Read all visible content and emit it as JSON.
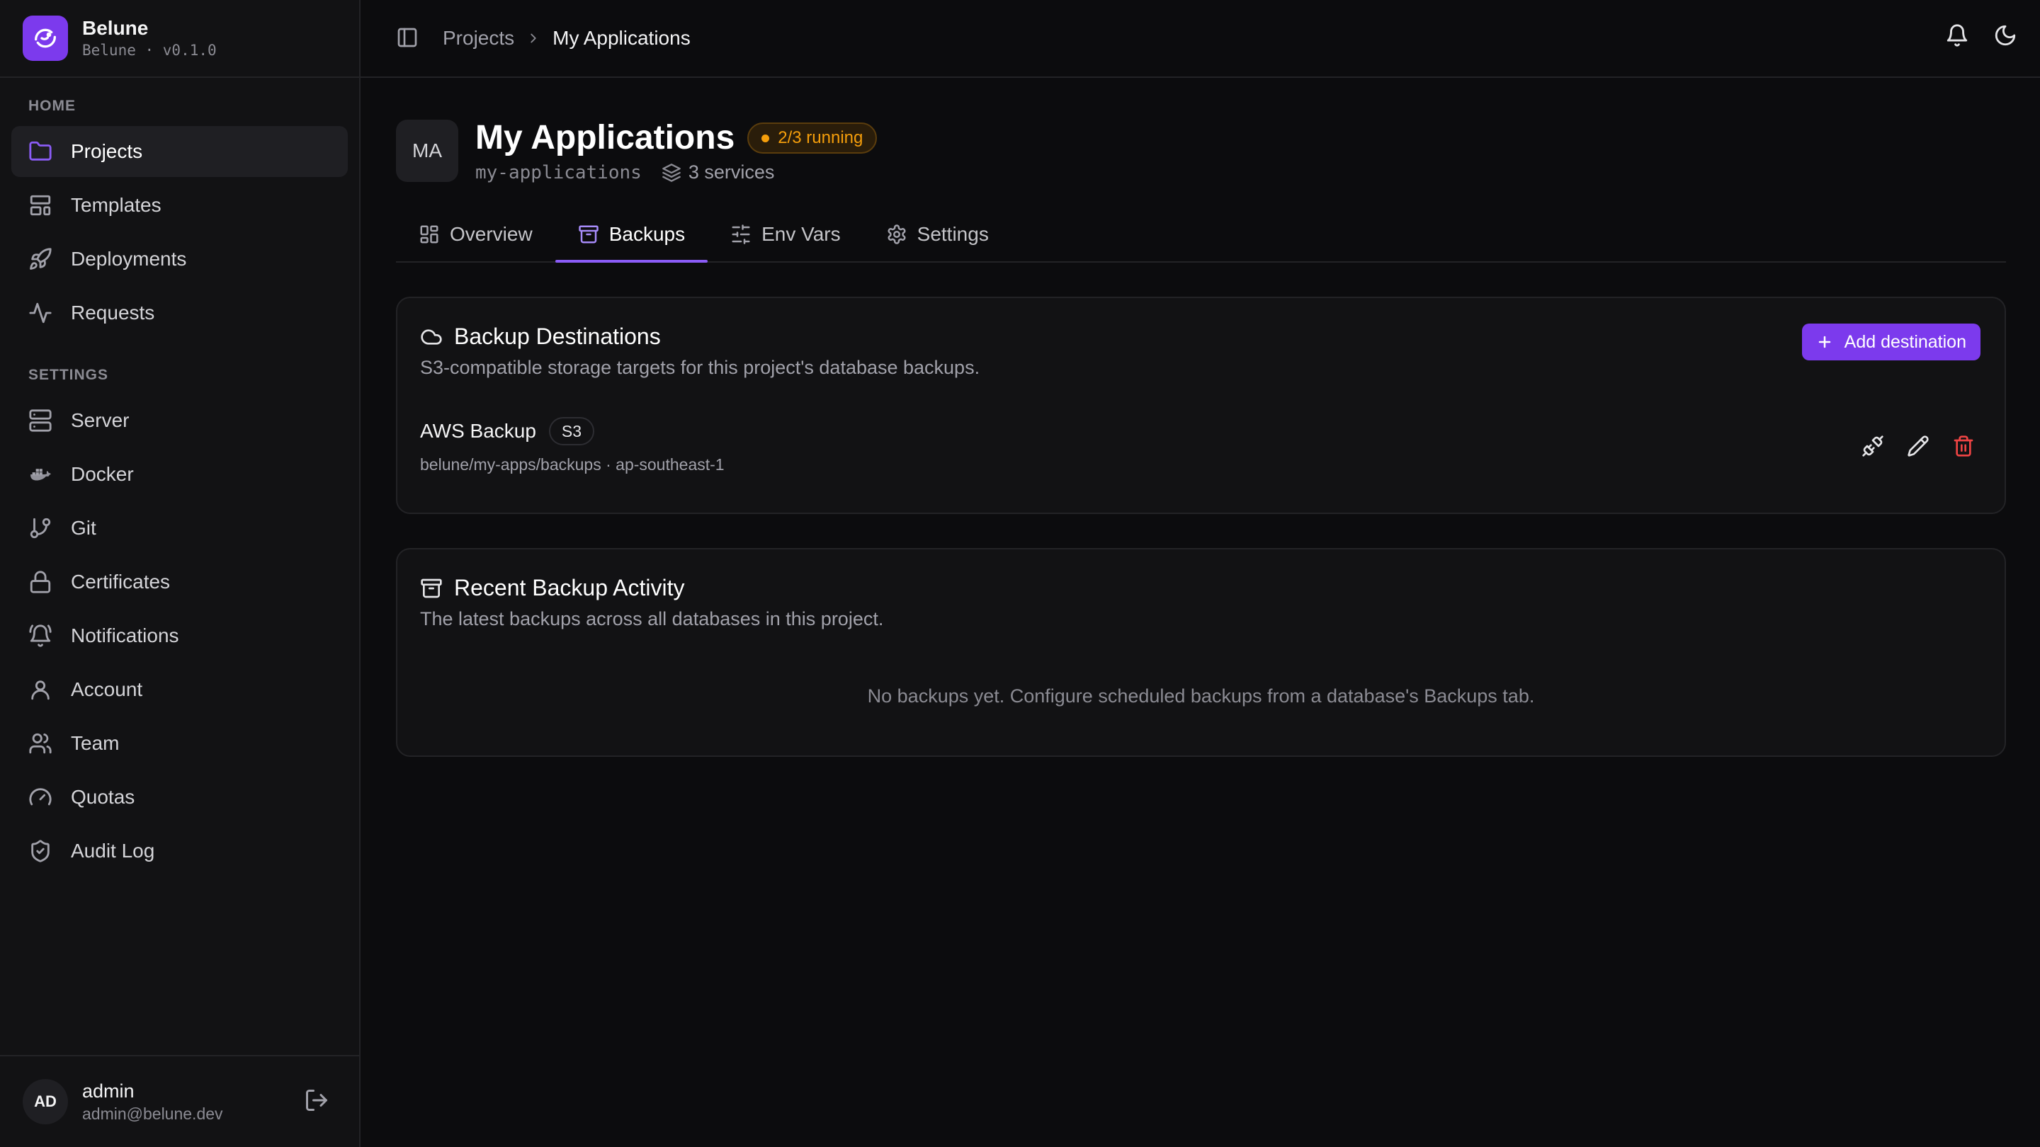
{
  "brand": {
    "name": "Belune",
    "sub": "Belune · v0.1.0"
  },
  "sidebar": {
    "home_label": "HOME",
    "home_items": [
      {
        "label": "Projects",
        "icon": "folder-icon",
        "active": true
      },
      {
        "label": "Templates",
        "icon": "layout-template-icon"
      },
      {
        "label": "Deployments",
        "icon": "rocket-icon"
      },
      {
        "label": "Requests",
        "icon": "activity-icon"
      }
    ],
    "settings_label": "SETTINGS",
    "settings_items": [
      {
        "label": "Server",
        "icon": "server-icon"
      },
      {
        "label": "Docker",
        "icon": "docker-icon"
      },
      {
        "label": "Git",
        "icon": "git-branch-icon"
      },
      {
        "label": "Certificates",
        "icon": "lock-icon"
      },
      {
        "label": "Notifications",
        "icon": "bell-ring-icon"
      },
      {
        "label": "Account",
        "icon": "user-icon"
      },
      {
        "label": "Team",
        "icon": "users-icon"
      },
      {
        "label": "Quotas",
        "icon": "gauge-icon"
      },
      {
        "label": "Audit Log",
        "icon": "shield-check-icon"
      }
    ]
  },
  "user": {
    "initials": "AD",
    "name": "admin",
    "email": "admin@belune.dev"
  },
  "breadcrumb": {
    "parent": "Projects",
    "current": "My Applications"
  },
  "project": {
    "initials": "MA",
    "title": "My Applications",
    "status": "2/3 running",
    "slug": "my-applications",
    "services": "3 services"
  },
  "tabs": [
    {
      "label": "Overview",
      "icon": "layout-grid-icon"
    },
    {
      "label": "Backups",
      "icon": "archive-icon",
      "active": true
    },
    {
      "label": "Env Vars",
      "icon": "sliders-icon"
    },
    {
      "label": "Settings",
      "icon": "gear-icon"
    }
  ],
  "destinations": {
    "title": "Backup Destinations",
    "description": "S3-compatible storage targets for this project's database backups.",
    "add_label": "Add destination",
    "items": [
      {
        "name": "AWS Backup",
        "type": "S3",
        "path": "belune/my-apps/backups · ap-southeast-1"
      }
    ]
  },
  "activity": {
    "title": "Recent Backup Activity",
    "description": "The latest backups across all databases in this project.",
    "empty": "No backups yet. Configure scheduled backups from a database's Backups tab."
  },
  "colors": {
    "accent": "#7c3aed",
    "warning": "#f59e0b",
    "danger": "#ef4444"
  }
}
